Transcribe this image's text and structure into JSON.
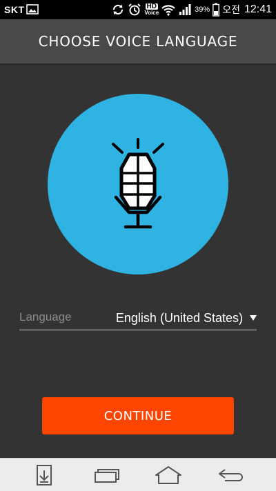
{
  "status_bar": {
    "carrier": "SKT",
    "hd_label": "HD",
    "voice_label": "Voice",
    "battery_percent": "39%",
    "ampm": "오전",
    "time": "12:41"
  },
  "header": {
    "title": "CHOOSE VOICE LANGUAGE"
  },
  "hero": {
    "circle_color": "#2fb3e3",
    "icon": "microphone-icon"
  },
  "language": {
    "label": "Language",
    "selected": "English (United States)"
  },
  "continue_button": {
    "label": "CONTINUE",
    "color": "#ff4500"
  },
  "nav_bar": {
    "items": [
      "download-icon",
      "recent-apps-icon",
      "home-icon",
      "back-icon"
    ]
  }
}
